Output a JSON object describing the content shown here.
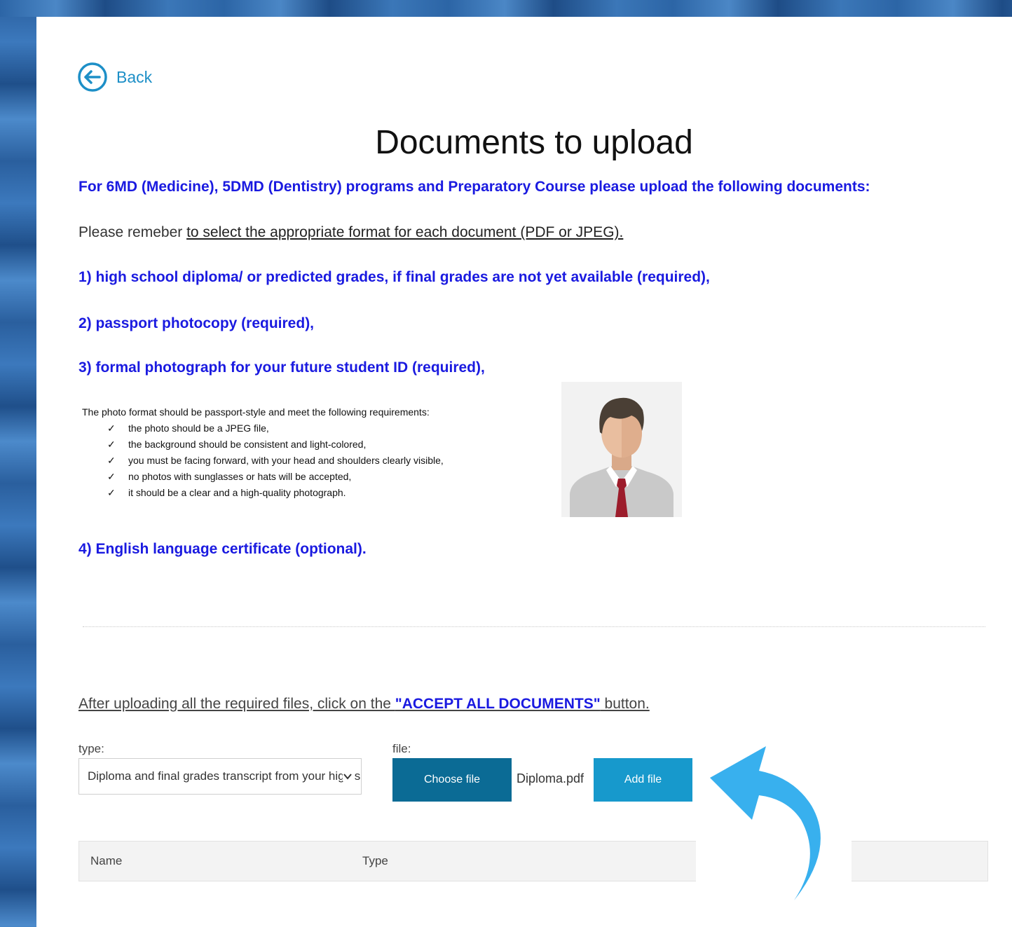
{
  "back": {
    "label": "Back"
  },
  "title": "Documents to upload",
  "intro": "For 6MD (Medicine), 5DMD (Dentistry) programs and Preparatory Course please upload the following documents:",
  "remember": {
    "prefix": "Please remeber ",
    "emphasis": "to select the appropriate format for each document (PDF or JPEG)."
  },
  "documents": [
    "1) high school diploma/ or predicted grades, if final grades are not yet available (required),",
    "2) passport photocopy (required),",
    "3) formal photograph for your future student ID (required),",
    "4) English language certificate (optional)."
  ],
  "photo_requirements": {
    "intro": "The photo format should be passport-style and meet the following requirements:",
    "items": [
      "the photo should be a JPEG file,",
      "the background should be consistent and light-colored,",
      "you must be facing forward, with your head and shoulders clearly visible,",
      "no photos with sunglasses or hats will be accepted,",
      "it should be a clear and a high-quality photograph."
    ]
  },
  "instruction": {
    "prefix": "After uploading all the required files, click on the ",
    "accept": "\"ACCEPT ALL DOCUMENTS\"",
    "suffix": " button."
  },
  "upload": {
    "type_label": "type:",
    "type_value": "Diploma and final grades transcript from your high school",
    "file_label": "file:",
    "choose_label": "Choose file",
    "file_name": "Diploma.pdf",
    "add_label": "Add file"
  },
  "table": {
    "columns": [
      "Name",
      "Type"
    ]
  },
  "colors": {
    "accent_blue": "#1a1ae0",
    "link_blue": "#1d8fc7",
    "choose_button": "#0b6b95",
    "add_button": "#1799cc",
    "arrow": "#38b0ee"
  }
}
